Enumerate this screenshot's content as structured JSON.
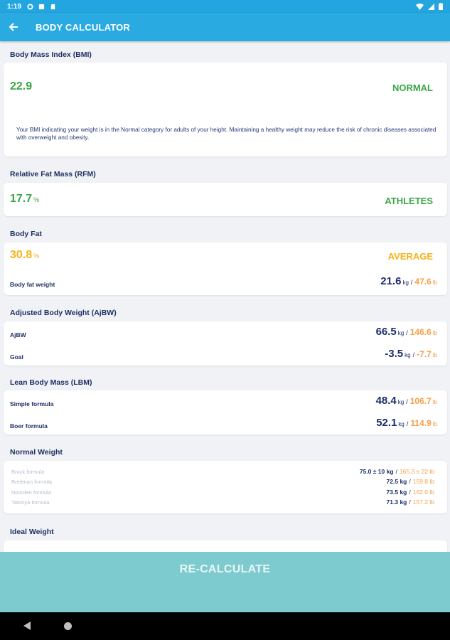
{
  "status_bar": {
    "time": "1:19"
  },
  "app_bar": {
    "title": "BODY CALCULATOR"
  },
  "bmi": {
    "title": "Body Mass Index (BMI)",
    "value": "22.9",
    "status": "NORMAL",
    "description": "Your BMI indicating your weight is in the Normal category for adults of your height. Maintaining a healthy weight may reduce the risk of chronic diseases associated with overweight and obesity."
  },
  "rfm": {
    "title": "Relative Fat Mass (RFM)",
    "value": "17.7",
    "unit": "%",
    "status": "ATHLETES"
  },
  "body_fat": {
    "title": "Body Fat",
    "value": "30.8",
    "unit": "%",
    "status": "AVERAGE",
    "weight_label": "Body fat weight",
    "weight_kg": "21.6",
    "weight_lb": "47.6"
  },
  "ajbw": {
    "title": "Adjusted Body Weight (AjBW)",
    "rows": [
      {
        "label": "AjBW",
        "kg": "66.5",
        "lb": "146.6"
      },
      {
        "label": "Goal",
        "kg": "-3.5",
        "lb": "-7.7"
      }
    ]
  },
  "lbm": {
    "title": "Lean Body Mass (LBM)",
    "rows": [
      {
        "label": "Simple formula",
        "kg": "48.4",
        "lb": "106.7"
      },
      {
        "label": "Boer formula",
        "kg": "52.1",
        "lb": "114.9"
      }
    ]
  },
  "normal_weight": {
    "title": "Normal Weight",
    "rows": [
      {
        "label": "Brock formula",
        "kg": "75.0 ± 10 kg",
        "lb": "165.3 ± 22 lb"
      },
      {
        "label": "Breitman formula",
        "kg": "72.5 kg",
        "lb": "159.8 lb"
      },
      {
        "label": "Noorden formula",
        "kg": "73.5 kg",
        "lb": "162.0 lb"
      },
      {
        "label": "Tatonya formula",
        "kg": "71.3 kg",
        "lb": "157.2 lb"
      }
    ]
  },
  "ideal_weight": {
    "title": "Ideal Weight"
  },
  "units": {
    "kg": "kg",
    "lb": "lb",
    "sep": "/"
  },
  "recalculate": {
    "label": "RE-CALCULATE"
  },
  "colors": {
    "accent": "#29abe2",
    "green": "#3aa648",
    "amber": "#f5b317",
    "navy": "#1b2d6b",
    "orange": "#f5a04a",
    "button": "#7ecbcf"
  }
}
